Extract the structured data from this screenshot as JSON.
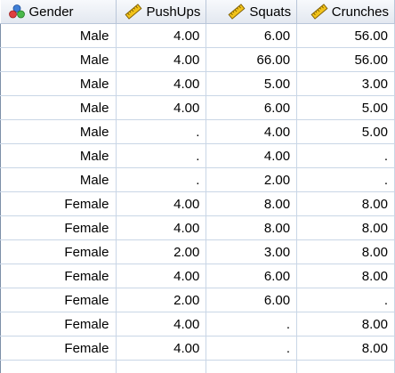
{
  "columns": [
    {
      "label": "Gender",
      "icon": "nominal-measure-icon"
    },
    {
      "label": "PushUps",
      "icon": "scale-measure-icon"
    },
    {
      "label": "Squats",
      "icon": "scale-measure-icon"
    },
    {
      "label": "Crunches",
      "icon": "scale-measure-icon"
    }
  ],
  "rows": [
    [
      "Male",
      "4.00",
      "6.00",
      "56.00"
    ],
    [
      "Male",
      "4.00",
      "66.00",
      "56.00"
    ],
    [
      "Male",
      "4.00",
      "5.00",
      "3.00"
    ],
    [
      "Male",
      "4.00",
      "6.00",
      "5.00"
    ],
    [
      "Male",
      ".",
      "4.00",
      "5.00"
    ],
    [
      "Male",
      ".",
      "4.00",
      "."
    ],
    [
      "Male",
      ".",
      "2.00",
      "."
    ],
    [
      "Female",
      "4.00",
      "8.00",
      "8.00"
    ],
    [
      "Female",
      "4.00",
      "8.00",
      "8.00"
    ],
    [
      "Female",
      "2.00",
      "3.00",
      "8.00"
    ],
    [
      "Female",
      "4.00",
      "6.00",
      "8.00"
    ],
    [
      "Female",
      "2.00",
      "6.00",
      "."
    ],
    [
      "Female",
      "4.00",
      ".",
      "8.00"
    ],
    [
      "Female",
      "4.00",
      ".",
      "8.00"
    ],
    [
      "",
      "",
      "",
      ""
    ]
  ],
  "colors": {
    "header_bg": "#e3e8f0",
    "grid_line": "#c9d6e6",
    "ruler_yellow": "#f2c31a"
  }
}
